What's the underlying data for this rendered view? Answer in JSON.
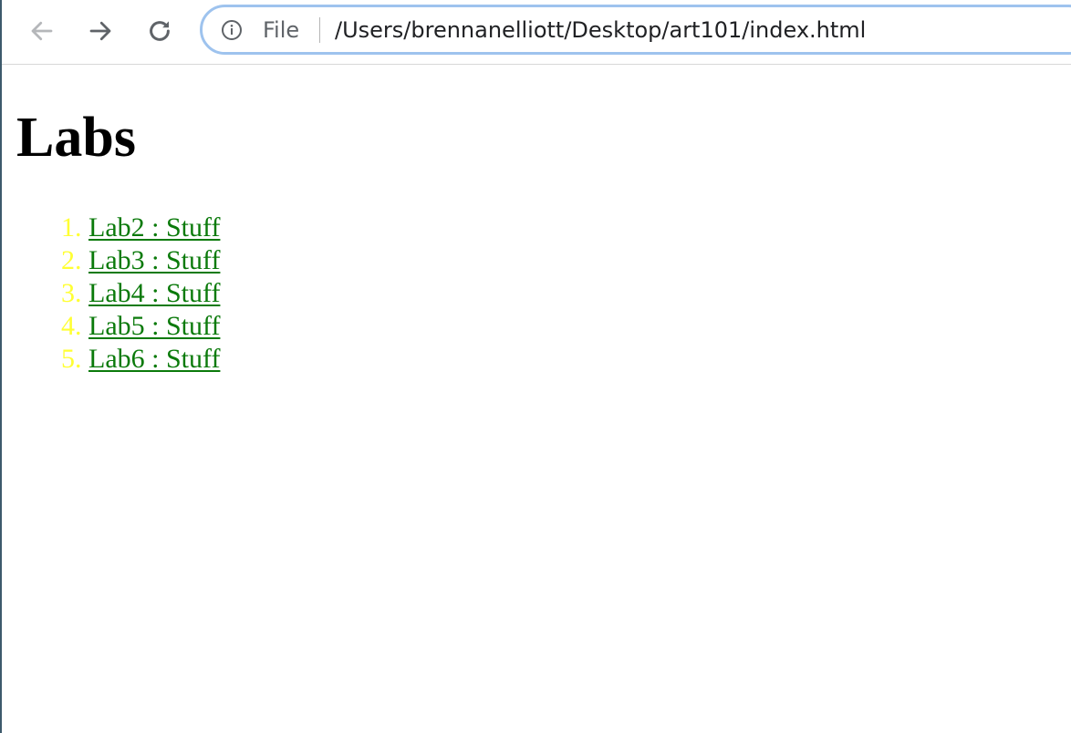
{
  "browser": {
    "address_bar": {
      "scheme_label": "File",
      "url": "/Users/brennanelliott/Desktop/art101/index.html"
    },
    "icons": {
      "back": "arrow-left-icon",
      "forward": "arrow-right-icon",
      "reload": "reload-icon",
      "site_info": "info-circle-icon"
    }
  },
  "page": {
    "heading": "Labs",
    "list_marker_color": "#ffff33",
    "link_color": "#0b7a0b",
    "items": [
      {
        "label": "Lab2 : Stuff"
      },
      {
        "label": "Lab3 : Stuff"
      },
      {
        "label": "Lab4 : Stuff"
      },
      {
        "label": "Lab5 : Stuff"
      },
      {
        "label": "Lab6 : Stuff"
      }
    ]
  }
}
